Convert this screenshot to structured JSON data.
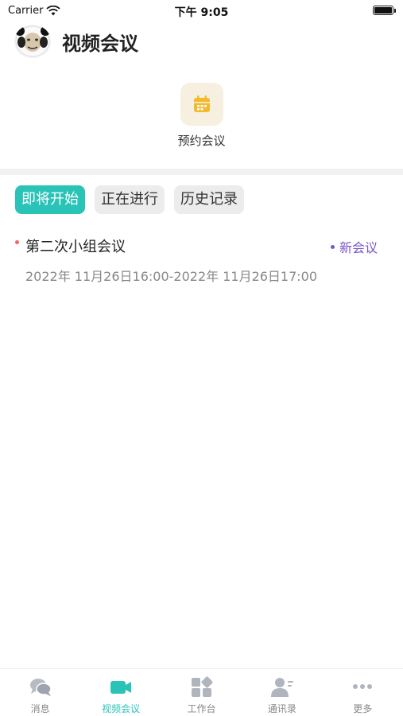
{
  "status_bar": {
    "carrier": "Carrier",
    "time": "下午 9:05"
  },
  "header": {
    "title": "视频会议"
  },
  "quick_action": {
    "label": "预约会议"
  },
  "tabs": [
    {
      "label": "即将开始",
      "active": true
    },
    {
      "label": "正在进行",
      "active": false
    },
    {
      "label": "历史记录",
      "active": false
    }
  ],
  "meetings": [
    {
      "title": "第二次小组会议",
      "status": "新会议",
      "time": "2022年 11月26日16:00-2022年 11月26日17:00"
    }
  ],
  "bottom_nav": [
    {
      "label": "消息",
      "icon": "chat-icon"
    },
    {
      "label": "视频会议",
      "icon": "video-camera-icon",
      "active": true
    },
    {
      "label": "工作台",
      "icon": "workbench-icon"
    },
    {
      "label": "通讯录",
      "icon": "contacts-icon"
    },
    {
      "label": "更多",
      "icon": "more-icon"
    }
  ],
  "colors": {
    "accent": "#2ac3b8",
    "status_purple": "#7a55c8",
    "quick_icon": "#f2bb2e",
    "indicator_red": "#f06565"
  }
}
